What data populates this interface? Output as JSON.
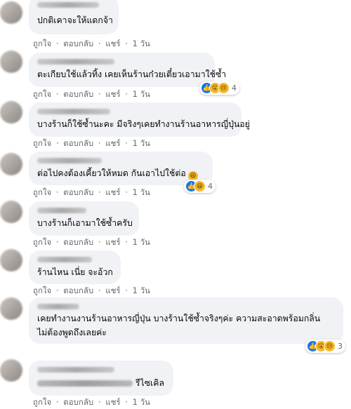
{
  "actions": {
    "like": "ถูกใจ",
    "reply": "ตอบกลับ",
    "share": "แชร์",
    "dot": "·",
    "time": "1 วัน"
  },
  "comments": [
    {
      "text": "ปกติเคาจะให้แดกจ้า"
    },
    {
      "text": "ตะเกียบใช้แล้วทิ้ง เคยเห็นร้านก๋วยเตี๋ยวเอามาใช้ซ้ำ",
      "reactions": [
        "like-icon",
        "wow-icon",
        "sad-icon"
      ],
      "count": "4"
    },
    {
      "text": "บางร้านก็ใช้ซ้ำนะคะ มีจริงๆเคยทำงานร้านอาหารญี่ปุ่นอยู่"
    },
    {
      "text": "ต่อไปคงต้องเคี้ยวให้หมด กันเอาไปใช้ต่อ",
      "reactions": [
        "like-icon",
        "haha-icon"
      ],
      "count": "4"
    },
    {
      "text": "บางร้านก็เอามาใช้ซ้ำครับ"
    },
    {
      "text": "ร้านไหน เนี่ย จะอ้วก"
    },
    {
      "line1": "เคยทำงานงานร้านอาหารญี่ปุ่น บางร้านใช้ซ้ำจริงๆค่ะ ความสะอาดพร้อมกลิ่น",
      "line2": "ไม่ต้องพูดถึงเลยค่ะ",
      "reactions": [
        "like-icon",
        "wow-icon",
        "sad-icon"
      ],
      "count": "3"
    },
    {
      "text": "รีไซเคิล"
    }
  ]
}
